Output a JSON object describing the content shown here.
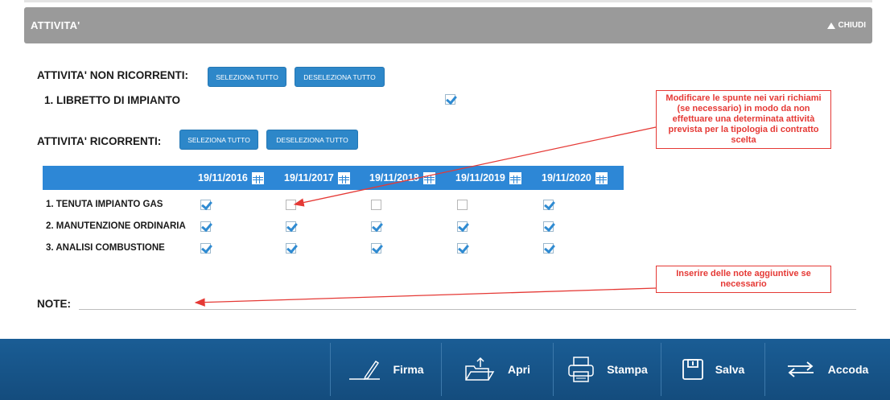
{
  "section": {
    "title": "ATTIVITA'",
    "toggle_label": "CHIUDI"
  },
  "non_recurring": {
    "label": "ATTIVITA' NON RICORRENTI:",
    "select_all": "SELEZIONA TUTTO",
    "deselect_all": "DESELEZIONA TUTTO",
    "items": [
      {
        "label": "1. LIBRETTO DI IMPIANTO",
        "checked": true
      }
    ]
  },
  "recurring": {
    "label": "ATTIVITA' RICORRENTI:",
    "select_all": "SELEZIONA TUTTO",
    "deselect_all": "DESELEZIONA TUTTO",
    "dates": [
      "19/11/2016",
      "19/11/2017",
      "19/11/2018",
      "19/11/2019",
      "19/11/2020"
    ],
    "rows": [
      {
        "label": "1. TENUTA IMPIANTO GAS",
        "checks": [
          true,
          false,
          false,
          false,
          true
        ]
      },
      {
        "label": "2. MANUTENZIONE ORDINARIA",
        "checks": [
          true,
          true,
          true,
          true,
          true
        ]
      },
      {
        "label": "3. ANALISI COMBUSTIONE",
        "checks": [
          true,
          true,
          true,
          true,
          true
        ]
      }
    ]
  },
  "note": {
    "label": "NOTE:",
    "value": ""
  },
  "callouts": {
    "checks": "Modificare le spunte nei vari richiami (se necessario) in modo da non effettuare una determinata attività prevista per la tipologia di contratto scelta",
    "notes": "Inserire delle note aggiuntive se necessario"
  },
  "toolbar": {
    "firma": "Firma",
    "apri": "Apri",
    "stampa": "Stampa",
    "salva": "Salva",
    "accoda": "Accoda"
  },
  "colors": {
    "accent": "#2d87d6",
    "button": "#2d87c9",
    "header": "#9a9a9a",
    "toolbar": "#1a5d95",
    "annotation": "#e53935"
  }
}
